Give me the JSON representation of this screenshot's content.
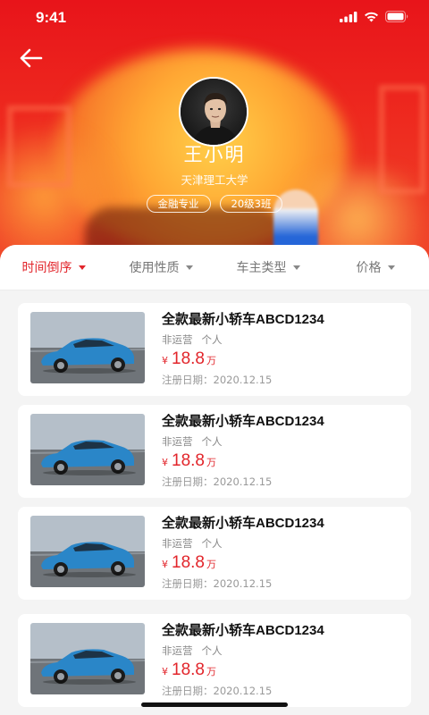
{
  "status_bar": {
    "time": "9:41"
  },
  "header": {
    "back_icon": "arrow-left-icon"
  },
  "profile": {
    "name": "王小明",
    "school": "天津理工大学",
    "tags": [
      "金融专业",
      "20级3班"
    ]
  },
  "filters": [
    {
      "label": "时间倒序",
      "active": true
    },
    {
      "label": "使用性质",
      "active": false
    },
    {
      "label": "车主类型",
      "active": false
    },
    {
      "label": "价格",
      "active": false
    }
  ],
  "listings": [
    {
      "title": "全款最新小轿车ABCD1234",
      "usage": "非运营",
      "owner": "个人",
      "currency": "¥",
      "price": "18.8",
      "unit": "万",
      "date": "注册日期：2020.12.15"
    },
    {
      "title": "全款最新小轿车ABCD1234",
      "usage": "非运营",
      "owner": "个人",
      "currency": "¥",
      "price": "18.8",
      "unit": "万",
      "date": "注册日期：2020.12.15"
    },
    {
      "title": "全款最新小轿车ABCD1234",
      "usage": "非运营",
      "owner": "个人",
      "currency": "¥",
      "price": "18.8",
      "unit": "万",
      "date": "注册日期：2020.12.15"
    },
    {
      "title": "全款最新小轿车ABCD1234",
      "usage": "非运营",
      "owner": "个人",
      "currency": "¥",
      "price": "18.8",
      "unit": "万",
      "date": "注册日期：2020.12.15"
    }
  ],
  "colors": {
    "brand_red": "#e2252b",
    "hero_red": "#e8141a"
  }
}
